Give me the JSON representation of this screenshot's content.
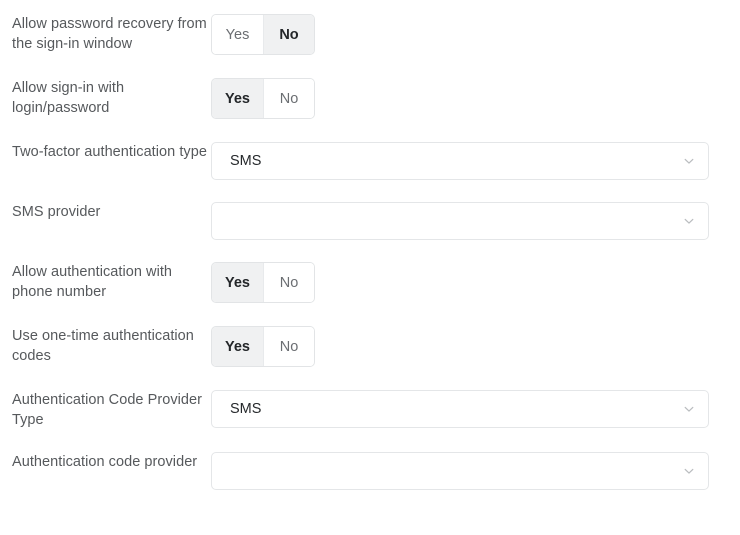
{
  "form": {
    "rows": [
      {
        "label": "Allow password recovery from the sign-in window",
        "type": "toggle",
        "options": [
          "Yes",
          "No"
        ],
        "selected": "No"
      },
      {
        "label": "Allow sign-in with login/password",
        "type": "toggle",
        "options": [
          "Yes",
          "No"
        ],
        "selected": "Yes"
      },
      {
        "label": "Two-factor authentication type",
        "type": "select",
        "value": "SMS",
        "icon": "chevron-down-icon"
      },
      {
        "label": "SMS provider",
        "type": "select",
        "value": "",
        "icon": "chevron-down-icon"
      },
      {
        "label": "Allow authentication with phone number",
        "type": "toggle",
        "options": [
          "Yes",
          "No"
        ],
        "selected": "Yes"
      },
      {
        "label": "Use one-time authentication codes",
        "type": "toggle",
        "options": [
          "Yes",
          "No"
        ],
        "selected": "Yes"
      },
      {
        "label": "Authentication Code Provider Type",
        "type": "select",
        "value": "SMS",
        "icon": "chevron-down-icon"
      },
      {
        "label": "Authentication code provider",
        "type": "select",
        "value": "",
        "icon": "chevron-down-icon"
      }
    ]
  },
  "colors": {
    "background": "#ffffff",
    "label_text": "#56595c",
    "value_text": "#26292c",
    "border": "#e4e6e8",
    "selected_segment_bg": "#f0f1f2",
    "selected_segment_text": "#232629",
    "unselected_segment_text": "#6b6e72",
    "chevron": "#b9bcbf"
  }
}
